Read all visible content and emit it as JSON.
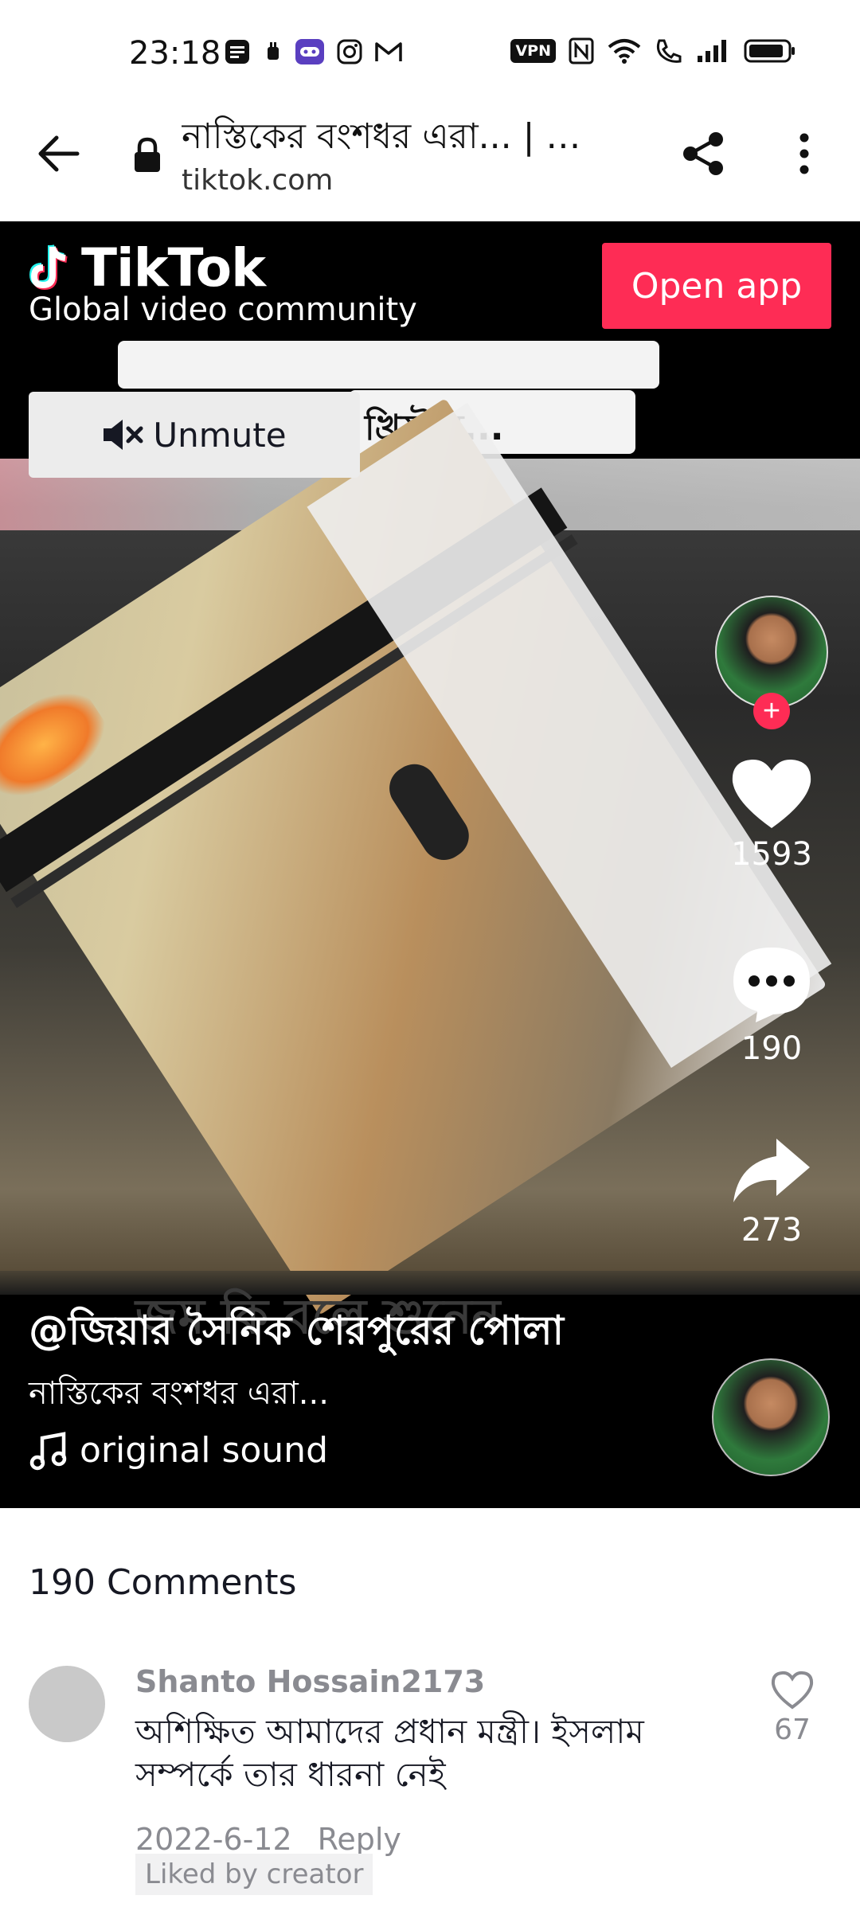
{
  "status_bar": {
    "time": "23:18",
    "vpn_label": "VPN",
    "left_icons": [
      "notes-icon",
      "notification-icon",
      "game-icon",
      "instagram-icon",
      "gmail-icon"
    ],
    "right_icons": [
      "vpn-icon",
      "nfc-icon",
      "wifi-icon",
      "call-icon",
      "signal-icon",
      "battery-icon"
    ]
  },
  "browser": {
    "title": "নাস্তিকের বংশধর এরা... | …",
    "url": "tiktok.com",
    "load_progress": 0.8
  },
  "video": {
    "brand": "TikTok",
    "tagline": "Global video community",
    "open_app_label": "Open app",
    "unmute_label": "Unmute",
    "frame_caption_top": "খ্রিস্টান...",
    "frame_caption_bottom": "জম কি বলে শুনেন",
    "likes": "1593",
    "comments": "190",
    "shares": "273",
    "author": "@জিয়ার সৈনিক শেরপুরের পোলা",
    "description": "নাস্তিকের বংশধর এরা...",
    "sound": "original sound"
  },
  "comments_section": {
    "title": "190 Comments",
    "items": [
      {
        "username": "Shanto Hossain2173",
        "text": "অশিক্ষিত আমাদের প্রধান মন্ত্রী। ইসলাম সম্পর্কে তার ধারনা নেই",
        "date": "2022-6-12",
        "reply_label": "Reply",
        "liked_label": "Liked by creator",
        "like_count": "67"
      }
    ]
  },
  "colors": {
    "accent": "#fe2c55",
    "video_bg": "#000000",
    "muted_text": "#8a8b91"
  }
}
